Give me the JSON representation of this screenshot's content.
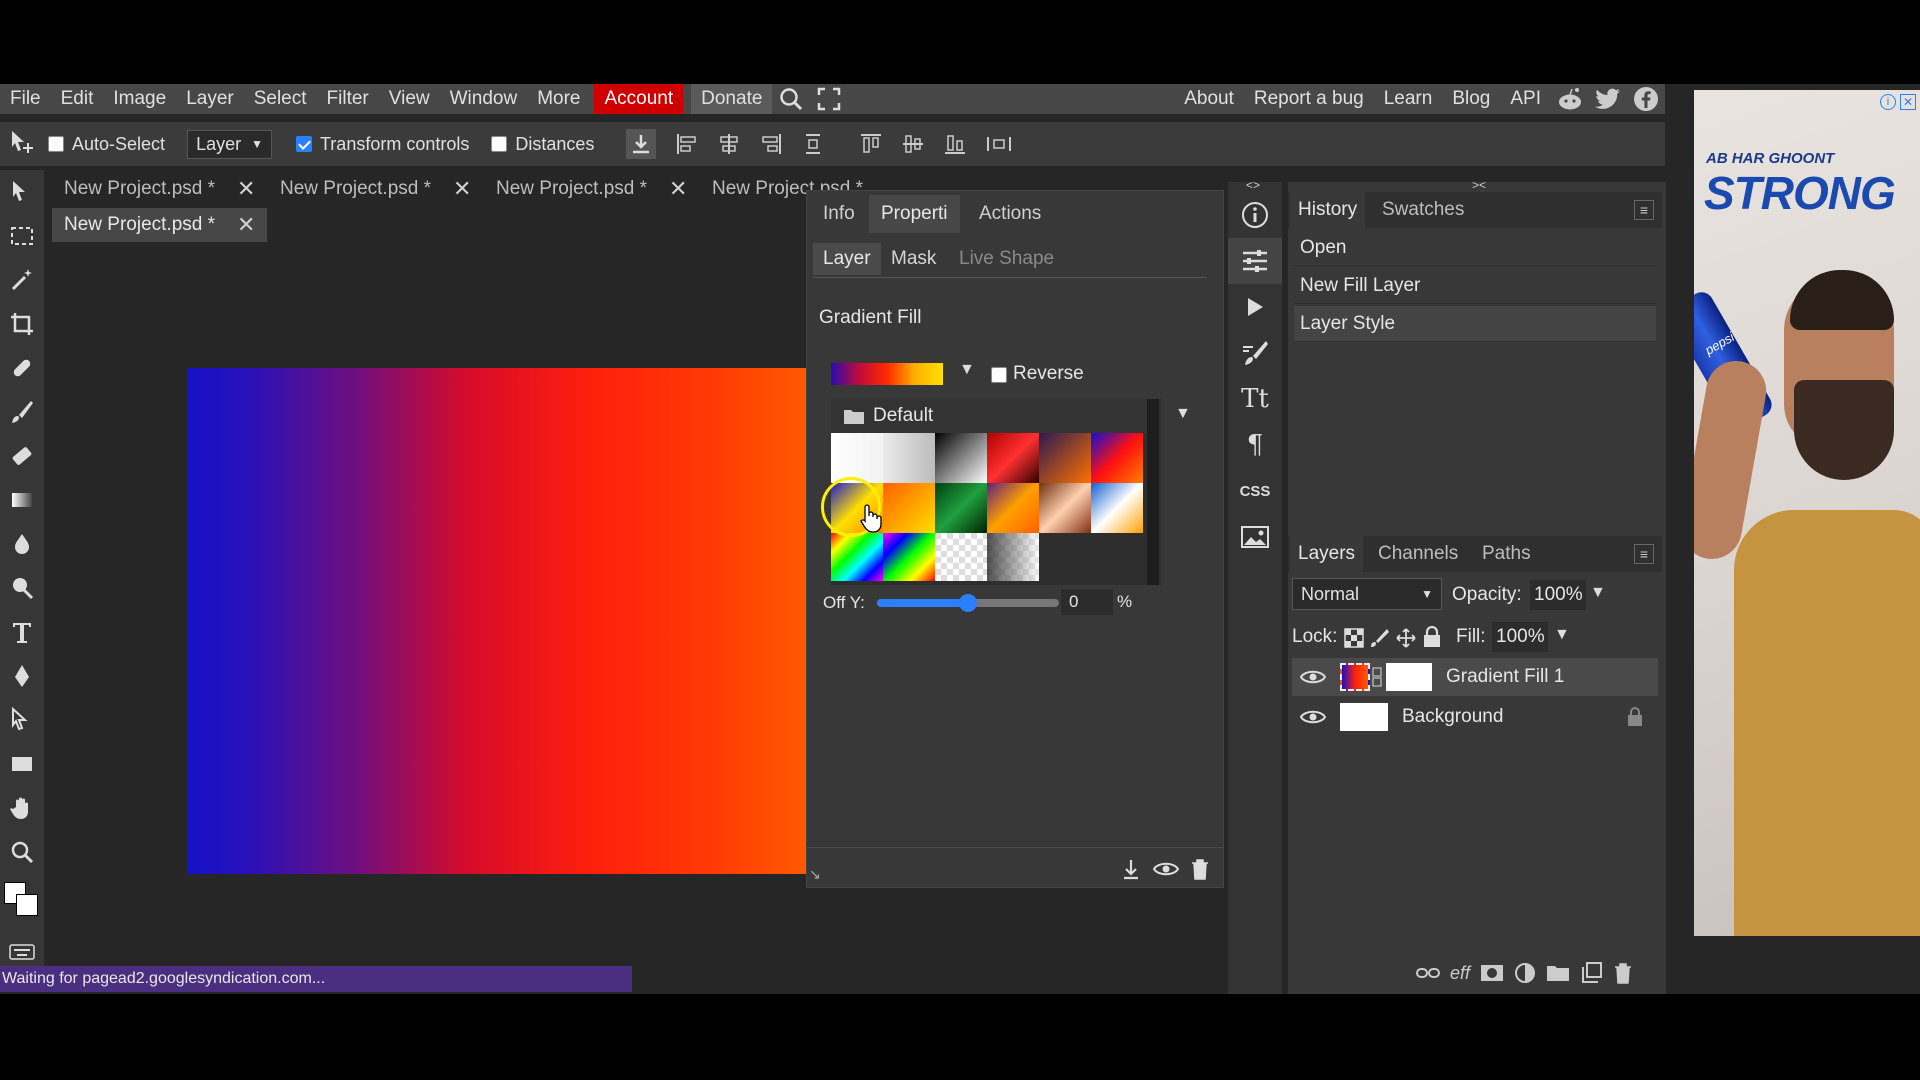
{
  "menubar": {
    "items": [
      "File",
      "Edit",
      "Image",
      "Layer",
      "Select",
      "Filter",
      "View",
      "Window",
      "More"
    ],
    "account": "Account",
    "donate": "Donate",
    "right_items": [
      "About",
      "Report a bug",
      "Learn",
      "Blog",
      "API"
    ],
    "right_icons": [
      "reddit-icon",
      "twitter-icon",
      "facebook-icon"
    ]
  },
  "options": {
    "auto_select": "Auto-Select",
    "auto_select_checked": false,
    "layer_select": "Layer",
    "transform_controls": "Transform controls",
    "transform_checked": true,
    "distances": "Distances",
    "distances_checked": false
  },
  "tabs": [
    {
      "label": "New Project.psd *"
    },
    {
      "label": "New Project.psd *"
    },
    {
      "label": "New Project.psd *"
    },
    {
      "label": "New Project.psd *"
    },
    {
      "label": "New Project.psd *"
    }
  ],
  "status": "Waiting for pagead2.googlesyndication.com...",
  "properties": {
    "tabs": [
      "Info",
      "Properti",
      "Actions"
    ],
    "subtabs": [
      "Layer",
      "Mask",
      "Live Shape"
    ],
    "title": "Gradient Fill",
    "reverse": "Reverse",
    "folder": "Default",
    "offy_label": "Off Y:",
    "offy_value": "0",
    "offy_unit": "%"
  },
  "history": {
    "tabs": [
      "History",
      "Swatches"
    ],
    "items": [
      "Open",
      "New Fill Layer",
      "Layer Style"
    ]
  },
  "layers": {
    "tabs": [
      "Layers",
      "Channels",
      "Paths"
    ],
    "blend": "Normal",
    "opacity_label": "Opacity:",
    "opacity": "100%",
    "lock_label": "Lock:",
    "fill_label": "Fill:",
    "fill": "100%",
    "rows": [
      {
        "name": "Gradient Fill 1",
        "selected": true
      },
      {
        "name": "Background",
        "locked": true
      }
    ],
    "bottom_icons": [
      "link-icon",
      "eff-icon",
      "mask-icon",
      "adjustment-icon",
      "folder-icon",
      "new-layer-icon",
      "trash-icon"
    ],
    "eff_label": "eff"
  },
  "ad": {
    "line1": "AB HAR GHOONT",
    "line2": "STRONG",
    "brand": "pepsi"
  },
  "colors": {
    "accent_account": "#d10000",
    "status_bg": "#4a2f80",
    "gradient_start": "#1512c8",
    "gradient_end": "#ff5a00"
  }
}
